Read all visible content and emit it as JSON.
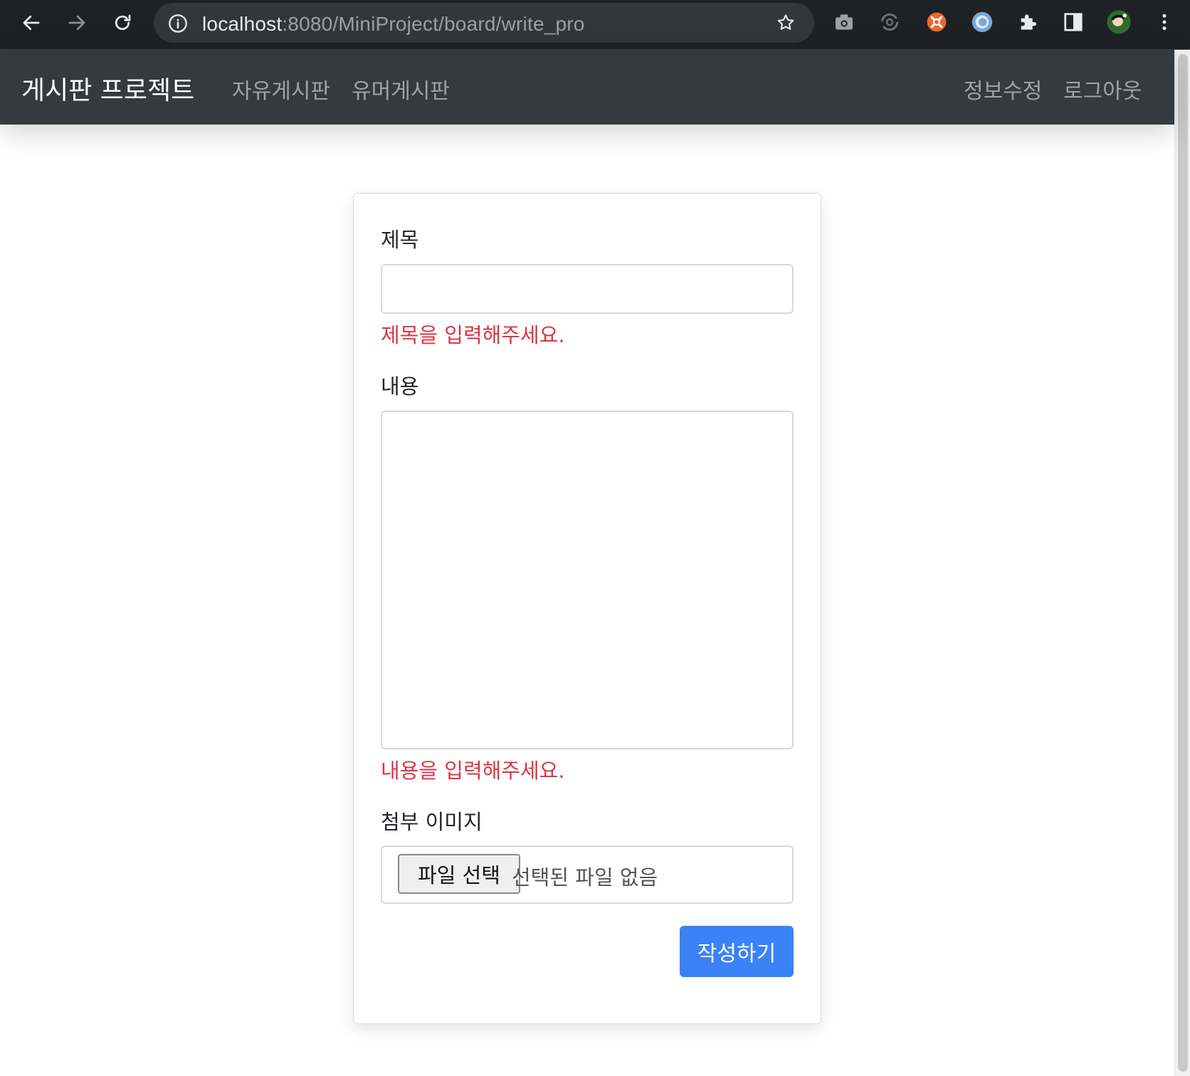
{
  "browser": {
    "url_host": "localhost",
    "url_rest": ":8080/MiniProject/board/write_pro",
    "icons": [
      "back-arrow-icon",
      "forward-arrow-icon",
      "reload-icon",
      "info-icon",
      "share-icon",
      "star-icon",
      "camera-icon",
      "sync-icon",
      "extension-orange-icon",
      "extension-blue-icon",
      "puzzle-icon",
      "sidepanel-icon",
      "avatar",
      "more-icon"
    ]
  },
  "navbar": {
    "brand": "게시판 프로젝트",
    "links": [
      "자유게시판",
      "유머게시판"
    ],
    "right_links": [
      "정보수정",
      "로그아웃"
    ]
  },
  "form": {
    "title_label": "제목",
    "title_value": "",
    "title_error": "제목을 입력해주세요.",
    "content_label": "내용",
    "content_value": "",
    "content_error": "내용을 입력해주세요.",
    "image_label": "첨부 이미지",
    "file_button": "파일 선택",
    "file_status": "선택된 파일 없음",
    "submit": "작성하기"
  },
  "colors": {
    "navbar_bg": "#343a40",
    "error": "#dc3545",
    "primary": "#3b82f6"
  }
}
